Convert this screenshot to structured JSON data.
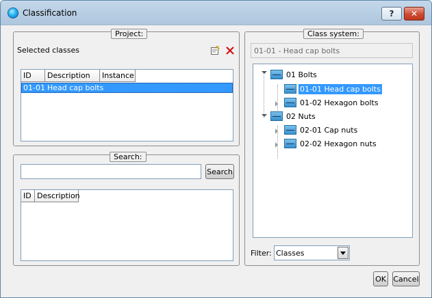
{
  "window": {
    "title": "Classification",
    "help_label": "?",
    "close_label": "✕"
  },
  "project": {
    "legend": "Project:",
    "selected_label": "Selected classes",
    "columns": [
      "ID",
      "Description",
      "Instance"
    ],
    "rows": [
      {
        "id": "01-01",
        "description": "Head cap bolts",
        "instance": ""
      }
    ]
  },
  "search": {
    "legend": "Search:",
    "input_value": "",
    "button_label": "Search",
    "columns": [
      "ID",
      "Description"
    ],
    "rows": []
  },
  "class_system": {
    "legend": "Class system:",
    "selected_path": "01-01 - Head cap bolts",
    "tree": [
      {
        "label": "01 Bolts",
        "expanded": true,
        "children": [
          {
            "label": "01-01 Head cap bolts",
            "selected": true
          },
          {
            "label": "01-02 Hexagon bolts"
          }
        ]
      },
      {
        "label": "02 Nuts",
        "expanded": true,
        "children": [
          {
            "label": "02-01 Cap nuts"
          },
          {
            "label": "02-02 Hexagon nuts"
          }
        ]
      }
    ],
    "filter_label": "Filter:",
    "filter_value": "Classes"
  },
  "footer": {
    "ok_label": "OK",
    "cancel_label": "Cancel"
  },
  "colors": {
    "selection": "#3399ff",
    "titlebar": "#b9cfe4",
    "close": "#c0391f"
  }
}
